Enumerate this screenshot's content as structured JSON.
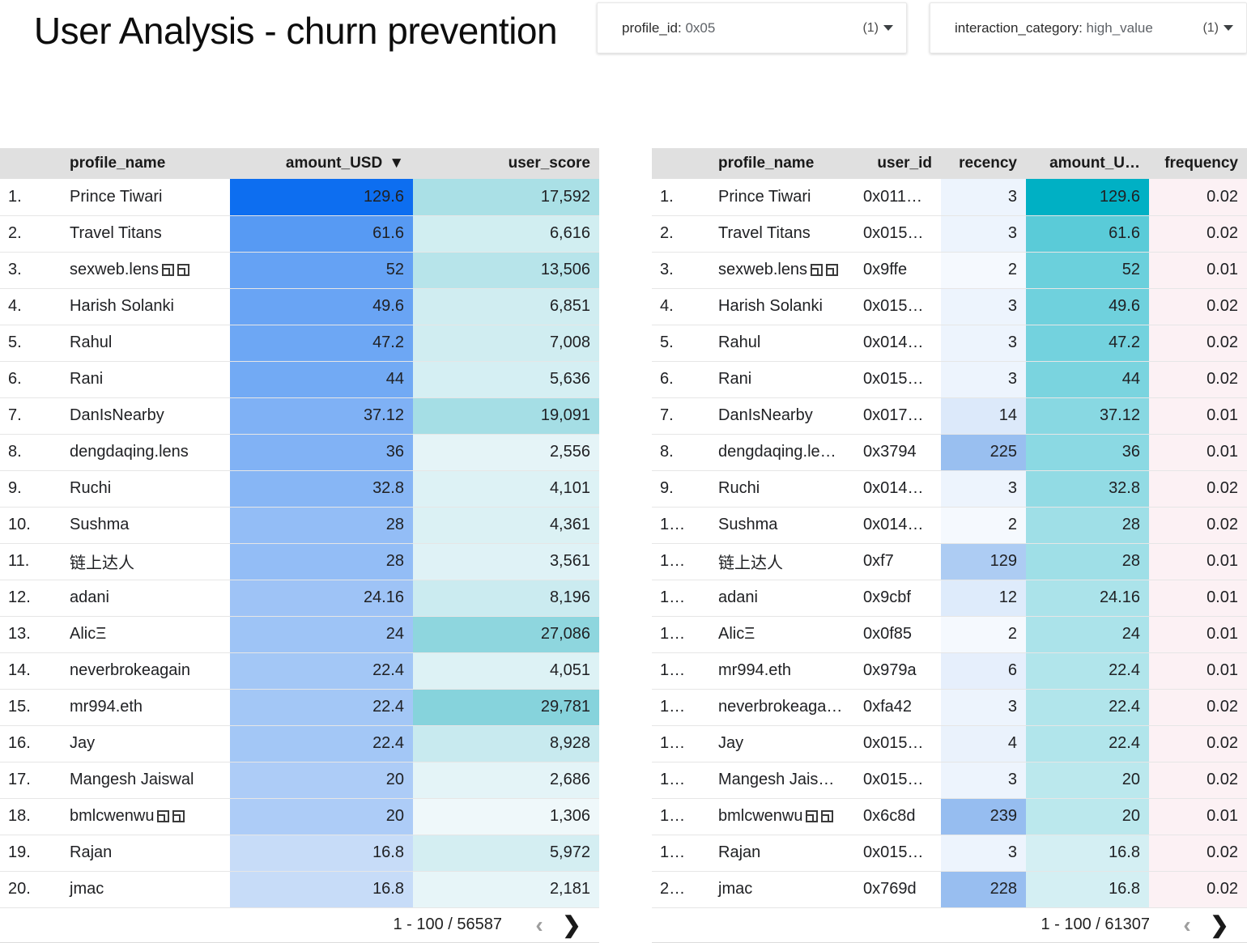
{
  "header": {
    "title": "User Analysis - churn prevention",
    "filters": [
      {
        "key": "profile_id",
        "separator": ": ",
        "value": "0x05",
        "count": "(1)",
        "icon": "chevron-down-icon"
      },
      {
        "key": "interaction_category",
        "separator": ": ",
        "value": "high_value",
        "count": "(1)",
        "icon": "chevron-down-icon"
      }
    ]
  },
  "colors": {
    "header_bg": "#e0e0e0",
    "amount_blue_max": "#0d6ef0",
    "amount_blue_min": "#c7dcf8",
    "score_teal_max": "#86d3dc",
    "score_teal_min": "#eff8fa",
    "amount_teal_max": "#00b0c4",
    "amount_teal_min": "#d4eff3",
    "recency_blue_max": "#96bdf0",
    "recency_blue_min": "#f5f9fe",
    "frequency_pink": "#fcf1f4"
  },
  "left_table": {
    "name": "amount-usd-ranking-table",
    "columns": [
      {
        "id": "index",
        "label": ""
      },
      {
        "id": "profile_name",
        "label": "profile_name"
      },
      {
        "id": "amount_USD",
        "label": "amount_USD",
        "sorted": true,
        "sort_icon": "sort-descending-icon"
      },
      {
        "id": "user_score",
        "label": "user_score"
      }
    ],
    "rows": [
      {
        "index": "1.",
        "profile_name": "Prince Tiwari",
        "tofu": 0,
        "amount_USD": "129.6",
        "amount_num": 129.6,
        "user_score": "17,592",
        "score_num": 17592
      },
      {
        "index": "2.",
        "profile_name": "Travel Titans",
        "tofu": 0,
        "amount_USD": "61.6",
        "amount_num": 61.6,
        "user_score": "6,616",
        "score_num": 6616
      },
      {
        "index": "3.",
        "profile_name": "sexweb.lens",
        "tofu": 2,
        "amount_USD": "52",
        "amount_num": 52,
        "user_score": "13,506",
        "score_num": 13506
      },
      {
        "index": "4.",
        "profile_name": "Harish Solanki",
        "tofu": 0,
        "amount_USD": "49.6",
        "amount_num": 49.6,
        "user_score": "6,851",
        "score_num": 6851
      },
      {
        "index": "5.",
        "profile_name": "Rahul",
        "tofu": 0,
        "amount_USD": "47.2",
        "amount_num": 47.2,
        "user_score": "7,008",
        "score_num": 7008
      },
      {
        "index": "6.",
        "profile_name": "Rani",
        "tofu": 0,
        "amount_USD": "44",
        "amount_num": 44,
        "user_score": "5,636",
        "score_num": 5636
      },
      {
        "index": "7.",
        "profile_name": "DanIsNearby",
        "tofu": 0,
        "amount_USD": "37.12",
        "amount_num": 37.12,
        "user_score": "19,091",
        "score_num": 19091
      },
      {
        "index": "8.",
        "profile_name": "dengdaqing.lens",
        "tofu": 0,
        "amount_USD": "36",
        "amount_num": 36,
        "user_score": "2,556",
        "score_num": 2556
      },
      {
        "index": "9.",
        "profile_name": "Ruchi",
        "tofu": 0,
        "amount_USD": "32.8",
        "amount_num": 32.8,
        "user_score": "4,101",
        "score_num": 4101
      },
      {
        "index": "10.",
        "profile_name": "Sushma",
        "tofu": 0,
        "amount_USD": "28",
        "amount_num": 28,
        "user_score": "4,361",
        "score_num": 4361
      },
      {
        "index": "11.",
        "profile_name": "链上达人",
        "tofu": 0,
        "amount_USD": "28",
        "amount_num": 28,
        "user_score": "3,561",
        "score_num": 3561
      },
      {
        "index": "12.",
        "profile_name": "adani",
        "tofu": 0,
        "amount_USD": "24.16",
        "amount_num": 24.16,
        "user_score": "8,196",
        "score_num": 8196
      },
      {
        "index": "13.",
        "profile_name": "AlicΞ",
        "tofu": 0,
        "amount_USD": "24",
        "amount_num": 24,
        "user_score": "27,086",
        "score_num": 27086
      },
      {
        "index": "14.",
        "profile_name": "neverbrokeagain",
        "tofu": 0,
        "amount_USD": "22.4",
        "amount_num": 22.4,
        "user_score": "4,051",
        "score_num": 4051
      },
      {
        "index": "15.",
        "profile_name": "mr994.eth",
        "tofu": 0,
        "amount_USD": "22.4",
        "amount_num": 22.4,
        "user_score": "29,781",
        "score_num": 29781
      },
      {
        "index": "16.",
        "profile_name": "Jay",
        "tofu": 0,
        "amount_USD": "22.4",
        "amount_num": 22.4,
        "user_score": "8,928",
        "score_num": 8928
      },
      {
        "index": "17.",
        "profile_name": "Mangesh Jaiswal",
        "tofu": 0,
        "amount_USD": "20",
        "amount_num": 20,
        "user_score": "2,686",
        "score_num": 2686
      },
      {
        "index": "18.",
        "profile_name": "bmlcwenwu",
        "tofu": 2,
        "amount_USD": "20",
        "amount_num": 20,
        "user_score": "1,306",
        "score_num": 1306
      },
      {
        "index": "19.",
        "profile_name": "Rajan",
        "tofu": 0,
        "amount_USD": "16.8",
        "amount_num": 16.8,
        "user_score": "5,972",
        "score_num": 5972
      },
      {
        "index": "20.",
        "profile_name": "jmac",
        "tofu": 0,
        "amount_USD": "16.8",
        "amount_num": 16.8,
        "user_score": "2,181",
        "score_num": 2181
      }
    ],
    "footer": {
      "page_label": "1 - 100 / 56587",
      "prev_icon": "chevron-left-icon",
      "next_icon": "chevron-right-icon"
    }
  },
  "right_table": {
    "name": "user-metrics-table",
    "columns": [
      {
        "id": "index",
        "label": ""
      },
      {
        "id": "profile_name",
        "label": "profile_name"
      },
      {
        "id": "user_id",
        "label": "user_id"
      },
      {
        "id": "recency",
        "label": "recency"
      },
      {
        "id": "amount_USD",
        "label": "amount_U…"
      },
      {
        "id": "frequency",
        "label": "frequency"
      }
    ],
    "rows": [
      {
        "index": "1.",
        "profile_name": "Prince Tiwari",
        "tofu": 0,
        "user_id": "0x011…",
        "recency": "3",
        "recency_num": 3,
        "amount_USD": "129.6",
        "amount_num": 129.6,
        "frequency": "0.02"
      },
      {
        "index": "2.",
        "profile_name": "Travel Titans",
        "tofu": 0,
        "user_id": "0x015…",
        "recency": "3",
        "recency_num": 3,
        "amount_USD": "61.6",
        "amount_num": 61.6,
        "frequency": "0.02"
      },
      {
        "index": "3.",
        "profile_name": "sexweb.lens",
        "tofu": 2,
        "user_id": "0x9ffe",
        "recency": "2",
        "recency_num": 2,
        "amount_USD": "52",
        "amount_num": 52,
        "frequency": "0.01"
      },
      {
        "index": "4.",
        "profile_name": "Harish Solanki",
        "tofu": 0,
        "user_id": "0x015…",
        "recency": "3",
        "recency_num": 3,
        "amount_USD": "49.6",
        "amount_num": 49.6,
        "frequency": "0.02"
      },
      {
        "index": "5.",
        "profile_name": "Rahul",
        "tofu": 0,
        "user_id": "0x014…",
        "recency": "3",
        "recency_num": 3,
        "amount_USD": "47.2",
        "amount_num": 47.2,
        "frequency": "0.02"
      },
      {
        "index": "6.",
        "profile_name": "Rani",
        "tofu": 0,
        "user_id": "0x015…",
        "recency": "3",
        "recency_num": 3,
        "amount_USD": "44",
        "amount_num": 44,
        "frequency": "0.02"
      },
      {
        "index": "7.",
        "profile_name": "DanIsNearby",
        "tofu": 0,
        "user_id": "0x017…",
        "recency": "14",
        "recency_num": 14,
        "amount_USD": "37.12",
        "amount_num": 37.12,
        "frequency": "0.01"
      },
      {
        "index": "8.",
        "profile_name": "dengdaqing.le…",
        "tofu": 0,
        "user_id": "0x3794",
        "recency": "225",
        "recency_num": 225,
        "amount_USD": "36",
        "amount_num": 36,
        "frequency": "0.01"
      },
      {
        "index": "9.",
        "profile_name": "Ruchi",
        "tofu": 0,
        "user_id": "0x014…",
        "recency": "3",
        "recency_num": 3,
        "amount_USD": "32.8",
        "amount_num": 32.8,
        "frequency": "0.02"
      },
      {
        "index": "1…",
        "profile_name": "Sushma",
        "tofu": 0,
        "user_id": "0x014…",
        "recency": "2",
        "recency_num": 2,
        "amount_USD": "28",
        "amount_num": 28,
        "frequency": "0.02"
      },
      {
        "index": "1…",
        "profile_name": "链上达人",
        "tofu": 0,
        "user_id": "0xf7",
        "recency": "129",
        "recency_num": 129,
        "amount_USD": "28",
        "amount_num": 28,
        "frequency": "0.01"
      },
      {
        "index": "1…",
        "profile_name": "adani",
        "tofu": 0,
        "user_id": "0x9cbf",
        "recency": "12",
        "recency_num": 12,
        "amount_USD": "24.16",
        "amount_num": 24.16,
        "frequency": "0.01"
      },
      {
        "index": "1…",
        "profile_name": "AlicΞ",
        "tofu": 0,
        "user_id": "0x0f85",
        "recency": "2",
        "recency_num": 2,
        "amount_USD": "24",
        "amount_num": 24,
        "frequency": "0.01"
      },
      {
        "index": "1…",
        "profile_name": "mr994.eth",
        "tofu": 0,
        "user_id": "0x979a",
        "recency": "6",
        "recency_num": 6,
        "amount_USD": "22.4",
        "amount_num": 22.4,
        "frequency": "0.01"
      },
      {
        "index": "1…",
        "profile_name": "neverbrokeaga…",
        "tofu": 0,
        "user_id": "0xfa42",
        "recency": "3",
        "recency_num": 3,
        "amount_USD": "22.4",
        "amount_num": 22.4,
        "frequency": "0.02"
      },
      {
        "index": "1…",
        "profile_name": "Jay",
        "tofu": 0,
        "user_id": "0x015…",
        "recency": "4",
        "recency_num": 4,
        "amount_USD": "22.4",
        "amount_num": 22.4,
        "frequency": "0.02"
      },
      {
        "index": "1…",
        "profile_name": "Mangesh Jais…",
        "tofu": 0,
        "user_id": "0x015…",
        "recency": "3",
        "recency_num": 3,
        "amount_USD": "20",
        "amount_num": 20,
        "frequency": "0.02"
      },
      {
        "index": "1…",
        "profile_name": "bmlcwenwu",
        "tofu": 2,
        "user_id": "0x6c8d",
        "recency": "239",
        "recency_num": 239,
        "amount_USD": "20",
        "amount_num": 20,
        "frequency": "0.01"
      },
      {
        "index": "1…",
        "profile_name": "Rajan",
        "tofu": 0,
        "user_id": "0x015…",
        "recency": "3",
        "recency_num": 3,
        "amount_USD": "16.8",
        "amount_num": 16.8,
        "frequency": "0.02"
      },
      {
        "index": "2…",
        "profile_name": "jmac",
        "tofu": 0,
        "user_id": "0x769d",
        "recency": "228",
        "recency_num": 228,
        "amount_USD": "16.8",
        "amount_num": 16.8,
        "frequency": "0.02"
      }
    ],
    "footer": {
      "page_label": "1 - 100 / 61307",
      "prev_icon": "chevron-left-icon",
      "next_icon": "chevron-right-icon"
    }
  }
}
